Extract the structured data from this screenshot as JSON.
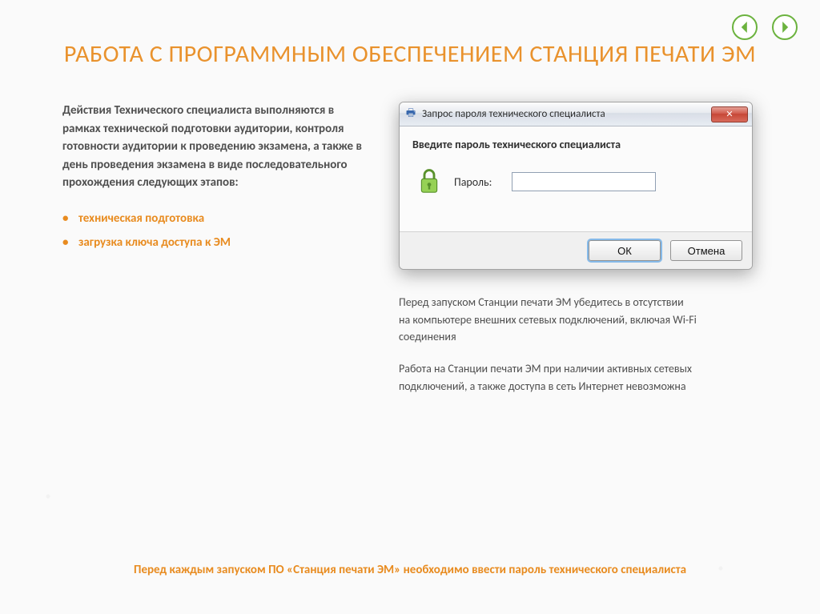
{
  "nav": {
    "prev": "prev",
    "next": "next"
  },
  "title": "РАБОТА С ПРОГРАММНЫМ ОБЕСПЕЧЕНИЕМ СТАНЦИЯ ПЕЧАТИ ЭМ",
  "left": {
    "intro": "Действия Технического специалиста выполняются в рамках технической подготовки аудитории, контроля готовности аудитории к проведению экзамена, а также в день проведения экзамена в виде последовательного прохождения следующих этапов:",
    "bullets": [
      "техническая подготовка",
      "загрузка ключа доступа к ЭМ"
    ]
  },
  "dialog": {
    "title": "Запрос пароля технического специалиста",
    "prompt": "Введите пароль технического специалиста",
    "password_label": "Пароль:",
    "password_value": "",
    "ok_label": "ОК",
    "cancel_label": "Отмена",
    "close_symbol": "✕"
  },
  "right_notes": {
    "p1": "Перед запуском Станции печати ЭМ убедитесь в отсутствии",
    "p1b": "на компьютере внешних сетевых подключений, включая Wi-Fi соединения",
    "p2": "Работа на Станции печати ЭМ при наличии активных сетевых подключений, а также доступа в сеть Интернет невозможна"
  },
  "footer": "Перед каждым запуском ПО «Станция печати ЭМ» необходимо ввести пароль технического специалиста"
}
